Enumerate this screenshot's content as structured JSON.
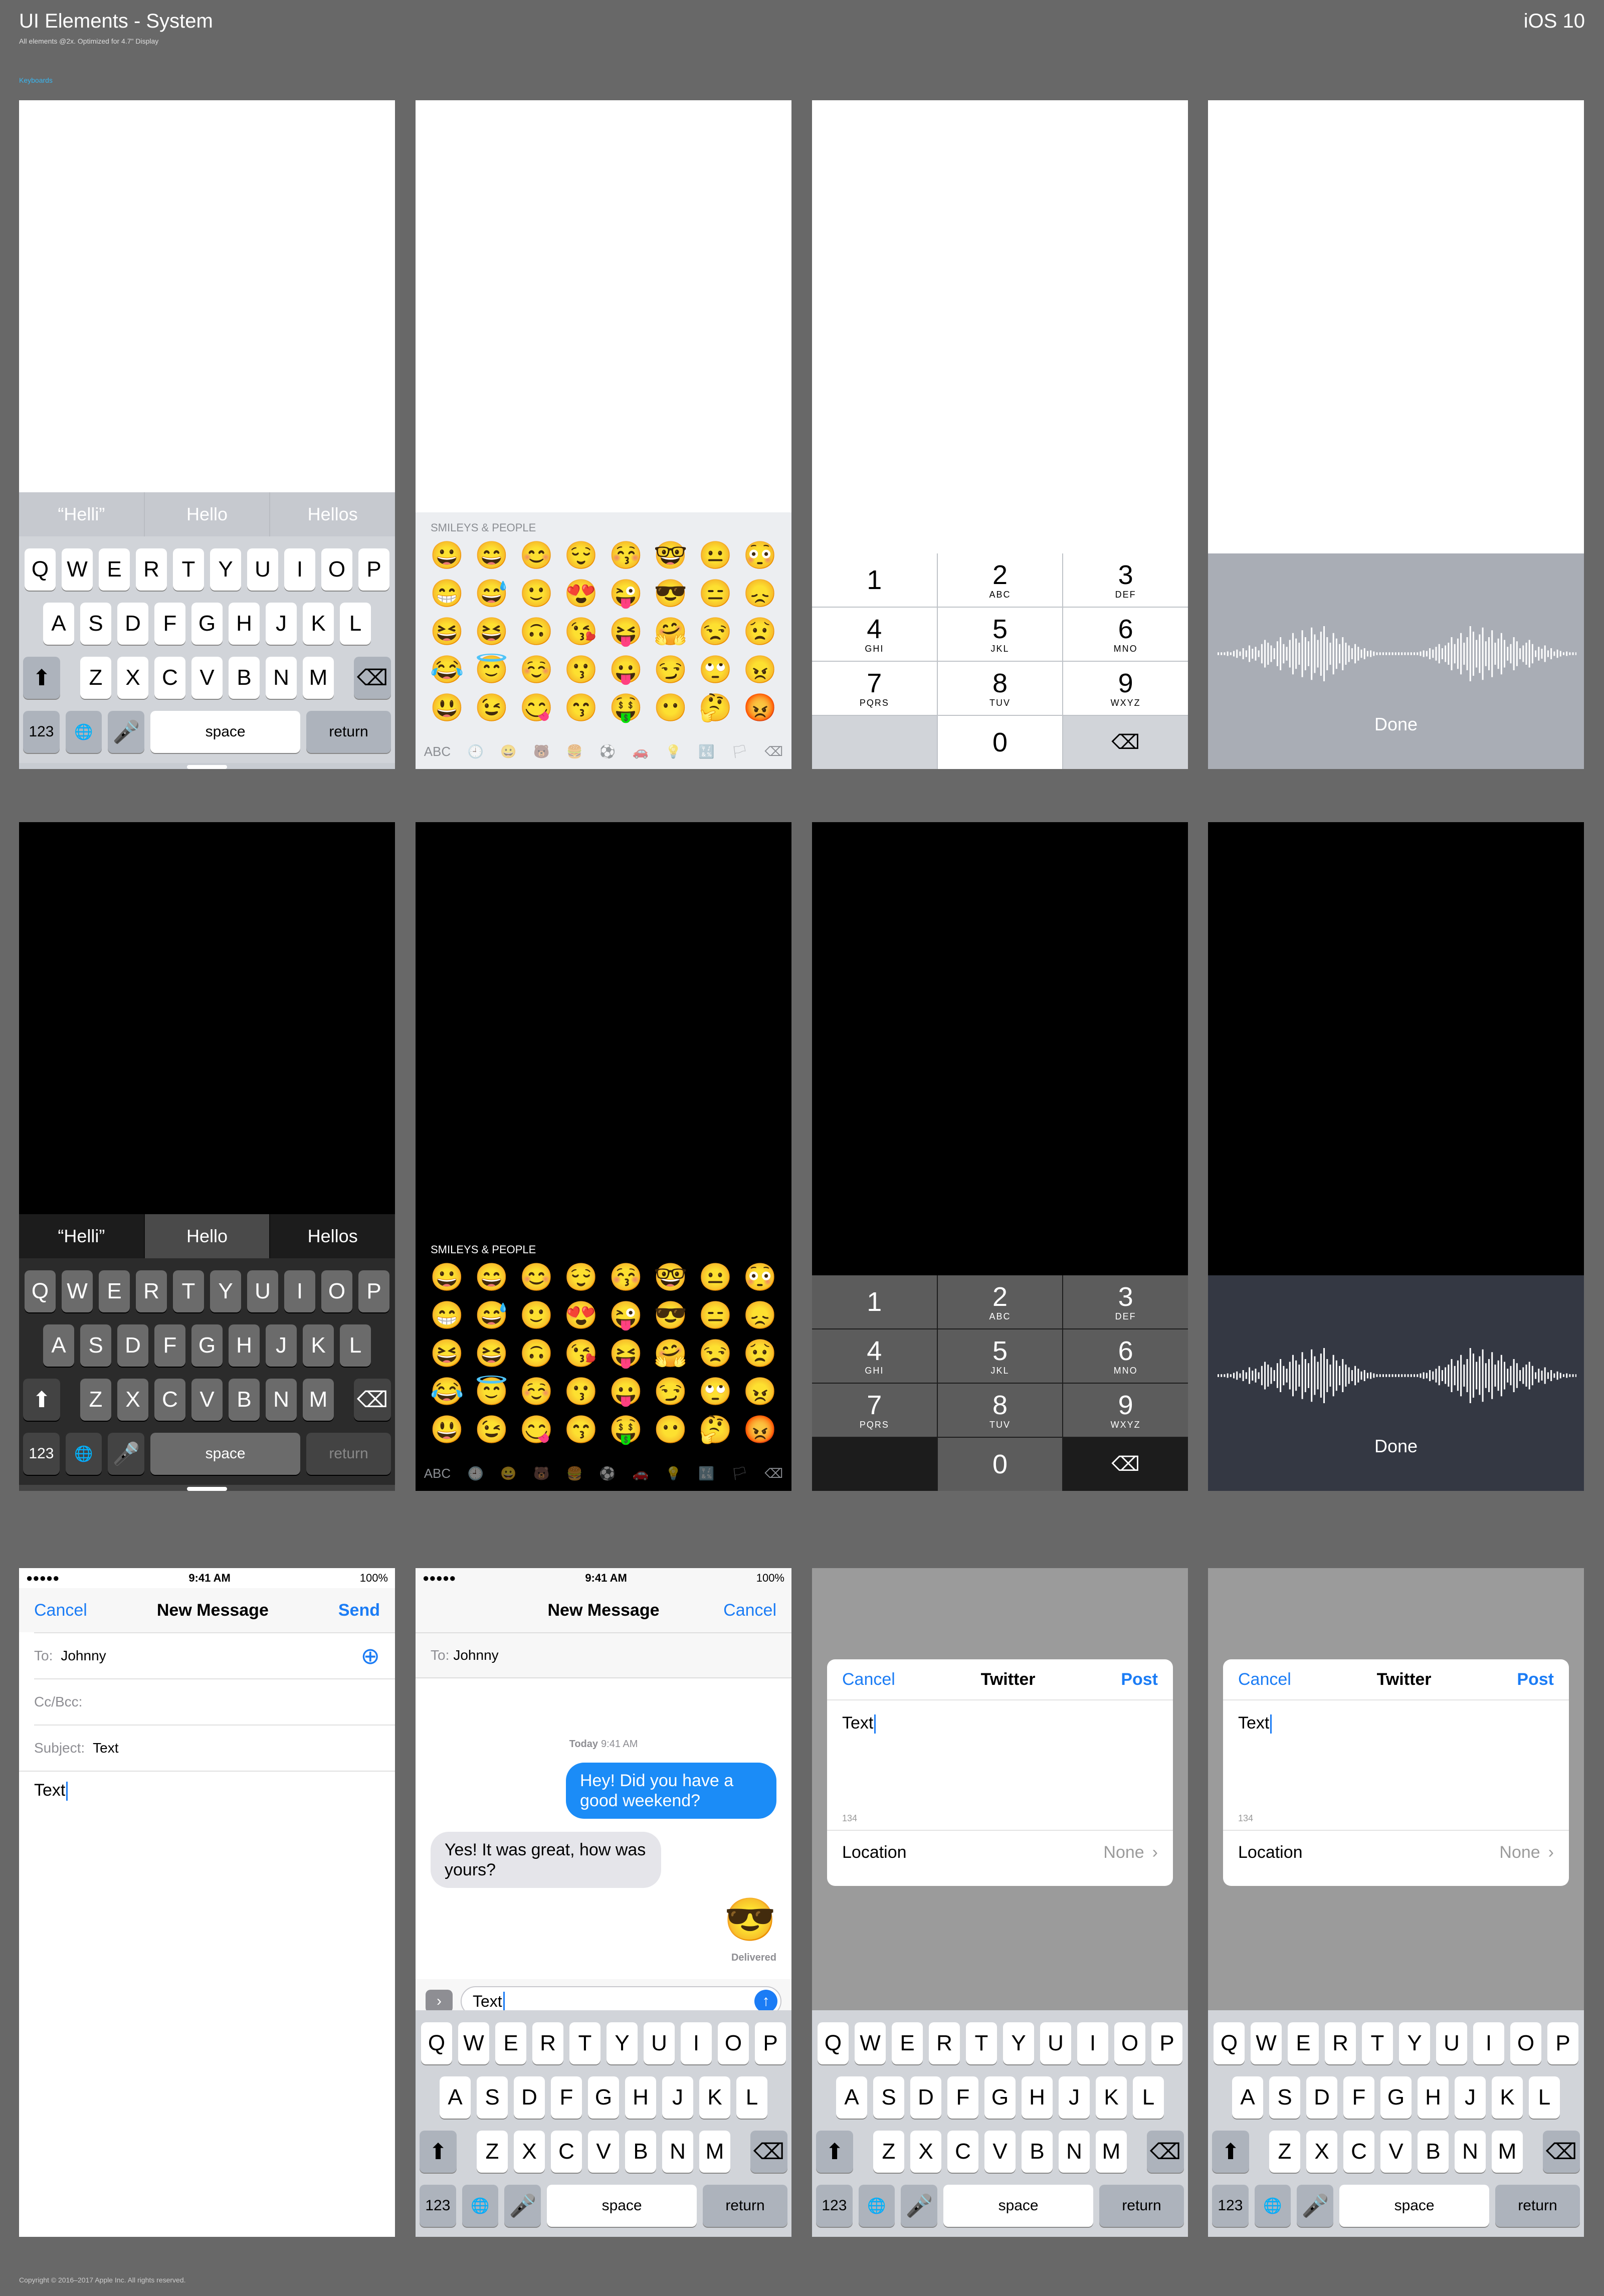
{
  "header": {
    "title": "UI Elements - System",
    "subtitle": "All elements @2x. Optimized for 4.7\" Display",
    "version": "iOS 10",
    "section_link": "Keyboards"
  },
  "footer": "Copyright © 2016–2017 Apple Inc. All rights reserved.",
  "keyboard": {
    "suggestions": [
      "“Helli”",
      "Hello",
      "Hellos"
    ],
    "row1": [
      "Q",
      "W",
      "E",
      "R",
      "T",
      "Y",
      "U",
      "I",
      "O",
      "P"
    ],
    "row2": [
      "A",
      "S",
      "D",
      "F",
      "G",
      "H",
      "J",
      "K",
      "L"
    ],
    "row3": [
      "Z",
      "X",
      "C",
      "V",
      "B",
      "N",
      "M"
    ],
    "numbers_label": "123",
    "space_label": "space",
    "return_label": "return",
    "shift_icon": "shift-icon",
    "delete_icon": "delete-icon",
    "globe_icon": "globe-icon",
    "mic_icon": "microphone-icon"
  },
  "emoji": {
    "category": "SMILEYS & PEOPLE",
    "abc_label": "ABC",
    "rows": [
      [
        "😀",
        "😄",
        "😊",
        "😌",
        "😚",
        "🤓",
        "😐",
        "😳"
      ],
      [
        "😁",
        "😅",
        "🙂",
        "😍",
        "😜",
        "😎",
        "😑",
        "😞"
      ],
      [
        "😆",
        "😆",
        "🙃",
        "😘",
        "😝",
        "🤗",
        "😒",
        "😟"
      ],
      [
        "😂",
        "😇",
        "☺️",
        "😗",
        "😛",
        "😏",
        "🙄",
        "😠"
      ],
      [
        "😃",
        "😉",
        "😋",
        "😙",
        "🤑",
        "😶",
        "🤔",
        "😡"
      ]
    ],
    "bar_icons": [
      "🕘",
      "😀",
      "🐻",
      "🍔",
      "⚽",
      "🚗",
      "💡",
      "🔣",
      "🏳"
    ]
  },
  "numpad": {
    "keys": [
      {
        "digit": "1",
        "letters": ""
      },
      {
        "digit": "2",
        "letters": "ABC"
      },
      {
        "digit": "3",
        "letters": "DEF"
      },
      {
        "digit": "4",
        "letters": "GHI"
      },
      {
        "digit": "5",
        "letters": "JKL"
      },
      {
        "digit": "6",
        "letters": "MNO"
      },
      {
        "digit": "7",
        "letters": "PQRS"
      },
      {
        "digit": "8",
        "letters": "TUV"
      },
      {
        "digit": "9",
        "letters": "WXYZ"
      },
      {
        "digit": "0",
        "letters": ""
      }
    ]
  },
  "dictation": {
    "done_label": "Done",
    "wave_levels": [
      0.05,
      0.05,
      0.05,
      0.08,
      0.05,
      0.1,
      0.15,
      0.08,
      0.2,
      0.12,
      0.3,
      0.18,
      0.25,
      0.12,
      0.35,
      0.5,
      0.4,
      0.3,
      0.2,
      0.45,
      0.6,
      0.35,
      0.25,
      0.5,
      0.75,
      0.55,
      0.4,
      0.85,
      0.6,
      0.45,
      0.95,
      0.7,
      0.5,
      0.8,
      1.0,
      0.6,
      0.4,
      0.75,
      0.55,
      0.35,
      0.6,
      0.4,
      0.3,
      0.2,
      0.35,
      0.25,
      0.15,
      0.2,
      0.1,
      0.12,
      0.08,
      0.05,
      0.05,
      0.05,
      0.05,
      0.05,
      0.05,
      0.05
    ]
  },
  "mail": {
    "status": {
      "carrier": "●●●●● ",
      "time": "9:41 AM",
      "battery": "100%"
    },
    "cancel": "Cancel",
    "title": "New Message",
    "send": "Send",
    "to_label": "To:",
    "to_value": "Johnny",
    "ccbcc_label": "Cc/Bcc:",
    "subject_label": "Subject:",
    "subject_value": "Text",
    "body": "Text"
  },
  "messages": {
    "status": {
      "carrier": "●●●●● ",
      "time": "9:41 AM",
      "battery": "100%"
    },
    "title": "New Message",
    "cancel": "Cancel",
    "to_label": "To:",
    "to_value": "Johnny",
    "timestamp_day": "Today",
    "timestamp_time": "9:41 AM",
    "outgoing": "Hey! Did you have a good weekend?",
    "incoming": "Yes! It was great, how was yours?",
    "emoji_reply": "😎",
    "delivered": "Delivered",
    "input_text": "Text"
  },
  "twitter": {
    "cancel": "Cancel",
    "title": "Twitter",
    "post": "Post",
    "text": "Text",
    "count": "134",
    "location_label": "Location",
    "location_value": "None"
  },
  "colors": {
    "ios_blue": "#1b7cf5",
    "background": "#686868"
  }
}
